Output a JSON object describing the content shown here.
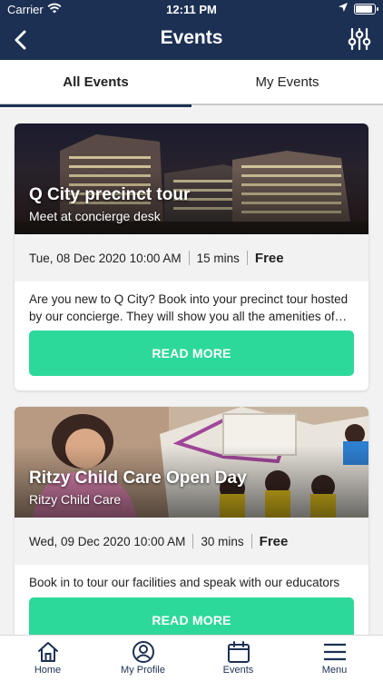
{
  "status_bar": {
    "carrier": "Carrier",
    "time": "12:11 PM"
  },
  "nav": {
    "title": "Events"
  },
  "tabs": [
    {
      "label": "All Events"
    },
    {
      "label": "My Events"
    }
  ],
  "events": [
    {
      "title": "Q City precinct tour",
      "subtitle": "Meet at concierge desk",
      "datetime": "Tue, 08 Dec 2020 10:00 AM",
      "duration": "15 mins",
      "price": "Free",
      "description": "Are you new to Q City?  Book into your precinct tour hosted by our concierge.  They will show you all the amenities of…",
      "cta": "READ MORE"
    },
    {
      "title": "Ritzy Child Care Open Day",
      "subtitle": "Ritzy Child Care",
      "datetime": "Wed, 09 Dec 2020 10:00 AM",
      "duration": "30 mins",
      "price": "Free",
      "description": "Book in to tour our facilities and speak with our educators",
      "cta": "READ MORE"
    }
  ],
  "bottom_nav": [
    {
      "label": "Home",
      "icon": "home-icon"
    },
    {
      "label": "My Profile",
      "icon": "profile-icon"
    },
    {
      "label": "Events",
      "icon": "calendar-icon"
    },
    {
      "label": "Menu",
      "icon": "menu-icon"
    }
  ],
  "colors": {
    "header": "#1c3053",
    "accent": "#2dd99a",
    "meta_bg": "#f2f2f2"
  }
}
